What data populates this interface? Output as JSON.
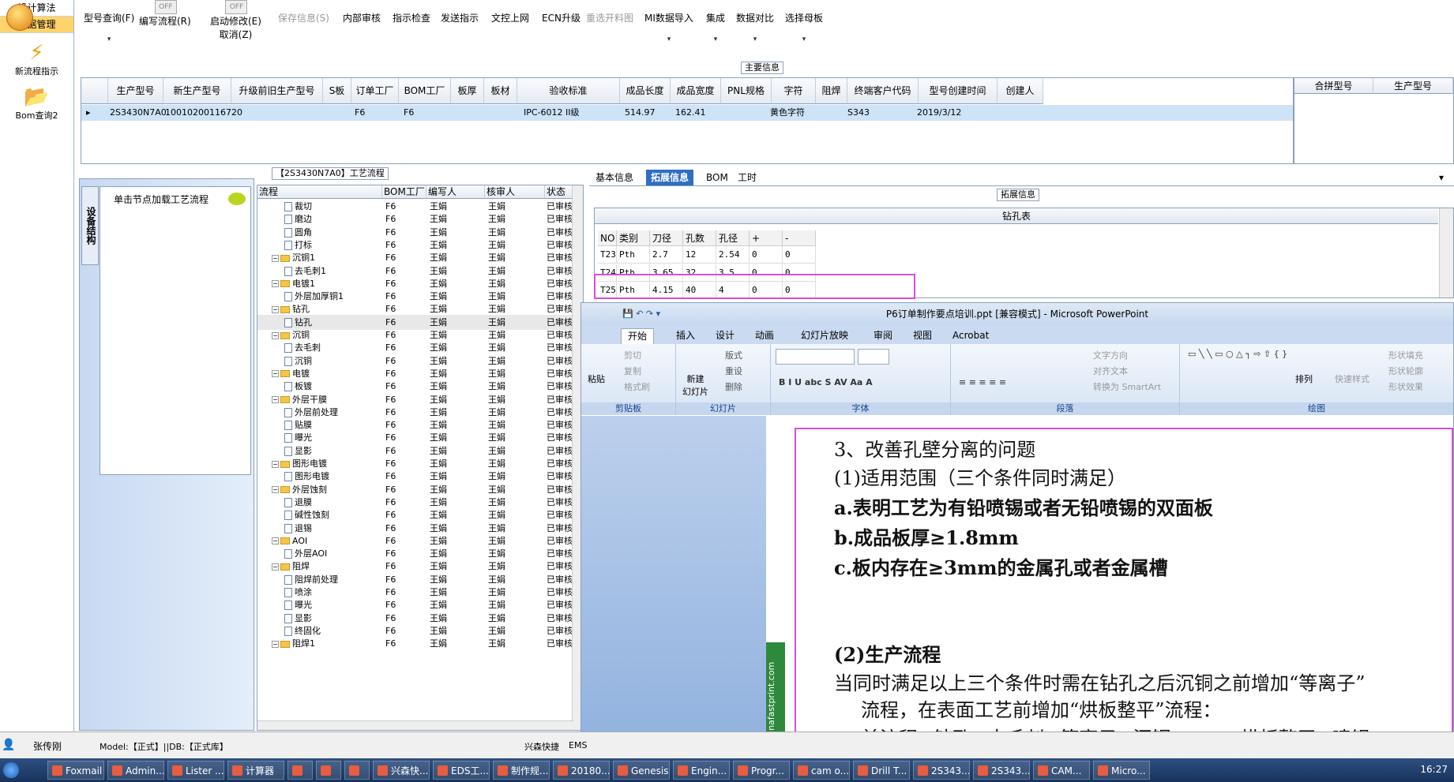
{
  "leftnav": {
    "items": [
      "设计算法",
      "数据管理"
    ],
    "big": [
      "新流程指示",
      "Bom查询2"
    ]
  },
  "toolbar": {
    "items": [
      "型号查询(F)",
      "保存信息(S)",
      "内部审核",
      "指示检查",
      "发送指示",
      "文控上网",
      "ECN升级",
      "重选开料图",
      "MI数据导入",
      "集成",
      "数据对比",
      "选择母板"
    ],
    "edit_flow": "编写流程(R)",
    "start_edit": "启动修改(E)",
    "cancel": "取消(Z)",
    "toggle": "OFF"
  },
  "main": {
    "section": "主要信息",
    "headers": [
      "生产型号",
      "新生产型号",
      "升级前旧生产型号",
      "S板",
      "订单工厂",
      "BOM工厂",
      "板厚",
      "板材",
      "验收标准",
      "成品长度",
      "成品宽度",
      "PNL规格",
      "字符",
      "阻焊",
      "终端客户代码",
      "型号创建时间",
      "创建人"
    ],
    "row": {
      "pn": "2S3430N7A0",
      "newpn": "10010200116720",
      "factory": "F6",
      "bom": "F6",
      "std": "IPC-6012 II级",
      "len": "514.97",
      "wid": "162.41",
      "char": "黄色字符",
      "cust": "S343",
      "date": "2019/3/12"
    },
    "merge_headers": [
      "合拼型号",
      "生产型号"
    ]
  },
  "flow": {
    "section": "【2S3430N7A0】工艺流程",
    "tab": "设备结构",
    "hint": "单击节点加载工艺流程",
    "headers": [
      "流程",
      "BOM工厂",
      "编写人",
      "核审人",
      "状态"
    ],
    "rows": [
      {
        "name": "裁切",
        "lvl": 2,
        "t": "p"
      },
      {
        "name": "磨边",
        "lvl": 2,
        "t": "p"
      },
      {
        "name": "圆角",
        "lvl": 2,
        "t": "p"
      },
      {
        "name": "打标",
        "lvl": 2,
        "t": "p"
      },
      {
        "name": "沉铜1",
        "lvl": 1,
        "t": "f"
      },
      {
        "name": "去毛刺1",
        "lvl": 2,
        "t": "p"
      },
      {
        "name": "电镀1",
        "lvl": 1,
        "t": "f"
      },
      {
        "name": "外层加厚铜1",
        "lvl": 2,
        "t": "p"
      },
      {
        "name": "钻孔",
        "lvl": 1,
        "t": "f"
      },
      {
        "name": "钻孔",
        "lvl": 2,
        "t": "p",
        "sel": true
      },
      {
        "name": "沉铜",
        "lvl": 1,
        "t": "f"
      },
      {
        "name": "去毛刺",
        "lvl": 2,
        "t": "p"
      },
      {
        "name": "沉铜",
        "lvl": 2,
        "t": "p"
      },
      {
        "name": "电镀",
        "lvl": 1,
        "t": "f"
      },
      {
        "name": "板镀",
        "lvl": 2,
        "t": "p"
      },
      {
        "name": "外层干膜",
        "lvl": 1,
        "t": "f"
      },
      {
        "name": "外层前处理",
        "lvl": 2,
        "t": "p"
      },
      {
        "name": "贴膜",
        "lvl": 2,
        "t": "p"
      },
      {
        "name": "曝光",
        "lvl": 2,
        "t": "p"
      },
      {
        "name": "显影",
        "lvl": 2,
        "t": "p"
      },
      {
        "name": "图形电镀",
        "lvl": 1,
        "t": "f"
      },
      {
        "name": "图形电镀",
        "lvl": 2,
        "t": "p"
      },
      {
        "name": "外层蚀刻",
        "lvl": 1,
        "t": "f"
      },
      {
        "name": "退膜",
        "lvl": 2,
        "t": "p"
      },
      {
        "name": "碱性蚀刻",
        "lvl": 2,
        "t": "p"
      },
      {
        "name": "退锡",
        "lvl": 2,
        "t": "p"
      },
      {
        "name": "AOI",
        "lvl": 1,
        "t": "f"
      },
      {
        "name": "外层AOI",
        "lvl": 2,
        "t": "p"
      },
      {
        "name": "阻焊",
        "lvl": 1,
        "t": "f"
      },
      {
        "name": "阻焊前处理",
        "lvl": 2,
        "t": "p"
      },
      {
        "name": "喷涂",
        "lvl": 2,
        "t": "p"
      },
      {
        "name": "曝光",
        "lvl": 2,
        "t": "p"
      },
      {
        "name": "显影",
        "lvl": 2,
        "t": "p"
      },
      {
        "name": "终固化",
        "lvl": 2,
        "t": "p"
      },
      {
        "name": "阻焊1",
        "lvl": 1,
        "t": "f"
      }
    ],
    "factory": "F6",
    "writer": "王娟",
    "reviewer": "王娟",
    "status": "已审核"
  },
  "right": {
    "tabs": [
      "基本信息",
      "拓展信息",
      "BOM",
      "工时"
    ],
    "section": "拓展信息",
    "drill_title": "钻孔表",
    "drill_headers": [
      "NO",
      "类别",
      "刀径",
      "孔数",
      "孔径",
      "+",
      "-"
    ],
    "drill_rows": [
      [
        "T23",
        "Pth",
        "2.7",
        "12",
        "2.54",
        "0",
        "0"
      ],
      [
        "T24",
        "Pth",
        "3.65",
        "32",
        "3.5",
        "0",
        "0"
      ],
      [
        "T25",
        "Pth",
        "4.15",
        "40",
        "4",
        "0",
        "0"
      ]
    ]
  },
  "ppt": {
    "title": "P6订单制作要点培训.ppt [兼容模式] - Microsoft PowerPoint",
    "tabs": [
      "开始",
      "插入",
      "设计",
      "动画",
      "幻灯片放映",
      "审阅",
      "视图",
      "Acrobat"
    ],
    "groups": [
      "剪贴板",
      "幻灯片",
      "字体",
      "段落",
      "绘图"
    ],
    "ribbon": {
      "paste": "粘贴",
      "cut": "剪切",
      "copy": "复制",
      "painter": "格式刷",
      "new_slide": "新建\n幻灯片",
      "layout": "版式",
      "reset": "重设",
      "delete": "删除",
      "text_dir": "文字方向",
      "align_text": "对齐文本",
      "smartart": "转换为 SmartArt",
      "arrange": "排列",
      "quick_style": "快速样式",
      "fill": "形状填充",
      "outline": "形状轮廓",
      "effect": "形状效果"
    },
    "sidebar_text": "chinafastprint.com",
    "lines": [
      {
        "t": "3、改善孔壁分离的问题",
        "b": false
      },
      {
        "t": "(1)适用范围（三个条件同时满足）",
        "b": false
      },
      {
        "t": "a.表明工艺为有铅喷锡或者无铅喷锡的双面板",
        "b": true
      },
      {
        "t": "b.成品板厚≥1.8mm",
        "b": true
      },
      {
        "t": "c.板内存在≥3mm的金属孔或者金属槽",
        "b": true
      },
      {
        "t": "(2)生产流程",
        "b": true
      },
      {
        "t": "当同时满足以上三个条件时需在钻孔之后沉铜之前增加“等离子”",
        "b": false
      },
      {
        "t": "流程，在表面工艺前增加“烘板整平”流程：",
        "b": false
      },
      {
        "t": "前流程→钻孔→去毛刺→等离子→沉铜→……→烘板整平→喷锡",
        "b": false
      }
    ]
  },
  "status": {
    "user": "张传刚",
    "model": "Model:【正式】||DB:【正式库】",
    "brand": "兴森快捷",
    "tail": "EMS"
  },
  "taskbar": [
    "Foxmail",
    "Admin...",
    "Lister ...",
    "计算器",
    "",
    "",
    "",
    "兴森快...",
    "EDS工...",
    "制作规...",
    "20180...",
    "Genesis",
    "Engin...",
    "Progr...",
    "cam o...",
    "Drill T...",
    "2S343...",
    "2S343...",
    "CAM...",
    "Micro..."
  ],
  "clock": "16:27"
}
